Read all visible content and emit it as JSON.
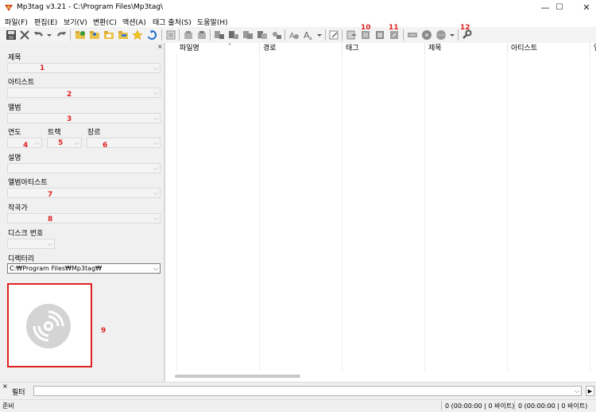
{
  "window": {
    "title": "Mp3tag v3.21  -  C:\\Program Files\\Mp3tag\\",
    "minimize": "—",
    "maximize": "☐",
    "close": "✕"
  },
  "menu": [
    "파일(F)",
    "편집(E)",
    "보기(V)",
    "변환(C)",
    "액션(A)",
    "태그 출처(S)",
    "도움말(H)"
  ],
  "toolbar": {
    "icons": [
      "save-icon",
      "remove-tag-icon",
      "undo-icon",
      "undo-dropdown-icon",
      "redo-icon",
      "change-directory-icon",
      "add-directory-icon",
      "open-folder-icon",
      "favorite-folder-icon",
      "favorites-star-icon",
      "refresh-icon",
      "list-view-icon",
      "copy-tag-icon",
      "paste-tag-icon",
      "tag-to-filename-icon",
      "filename-to-tag-icon",
      "text-to-tag-icon",
      "tag-to-tag-icon",
      "autonumber-icon",
      "case-conversion-icon",
      "replace-icon",
      "edit-tag-icon",
      "export-icon",
      "playlist-icon",
      "actions-icon",
      "convert-icon",
      "web-source-icon",
      "freedb-icon",
      "options-icon"
    ],
    "annotations": [
      "10",
      "11",
      "12"
    ]
  },
  "panel": {
    "close": "×",
    "fields": {
      "title": "제목",
      "artist": "아티스트",
      "album": "앨범",
      "year": "연도",
      "track": "트랙",
      "genre": "장르",
      "comment": "설명",
      "album_artist": "앨범아티스트",
      "composer": "작곡가",
      "disc": "디스크 번호",
      "directory": "디렉터리"
    },
    "directory_value": "C:₩Program Files₩Mp3tag₩",
    "annotations": [
      "1",
      "2",
      "3",
      "4",
      "5",
      "6",
      "7",
      "8",
      "9"
    ]
  },
  "list": {
    "columns": [
      "파일명",
      "경로",
      "태그",
      "제목",
      "아티스트",
      "앨"
    ],
    "sort_indicator": "^"
  },
  "filter": {
    "label": "필터",
    "value": "",
    "arrow": "▶"
  },
  "status": {
    "ready": "준비",
    "selected": "0 (00:00:00 | 0 바이트)",
    "total": "0 (00:00:00 | 0 바이트)"
  },
  "colors": {
    "annotation": "#e02020",
    "accent": "#1e6fd0"
  }
}
